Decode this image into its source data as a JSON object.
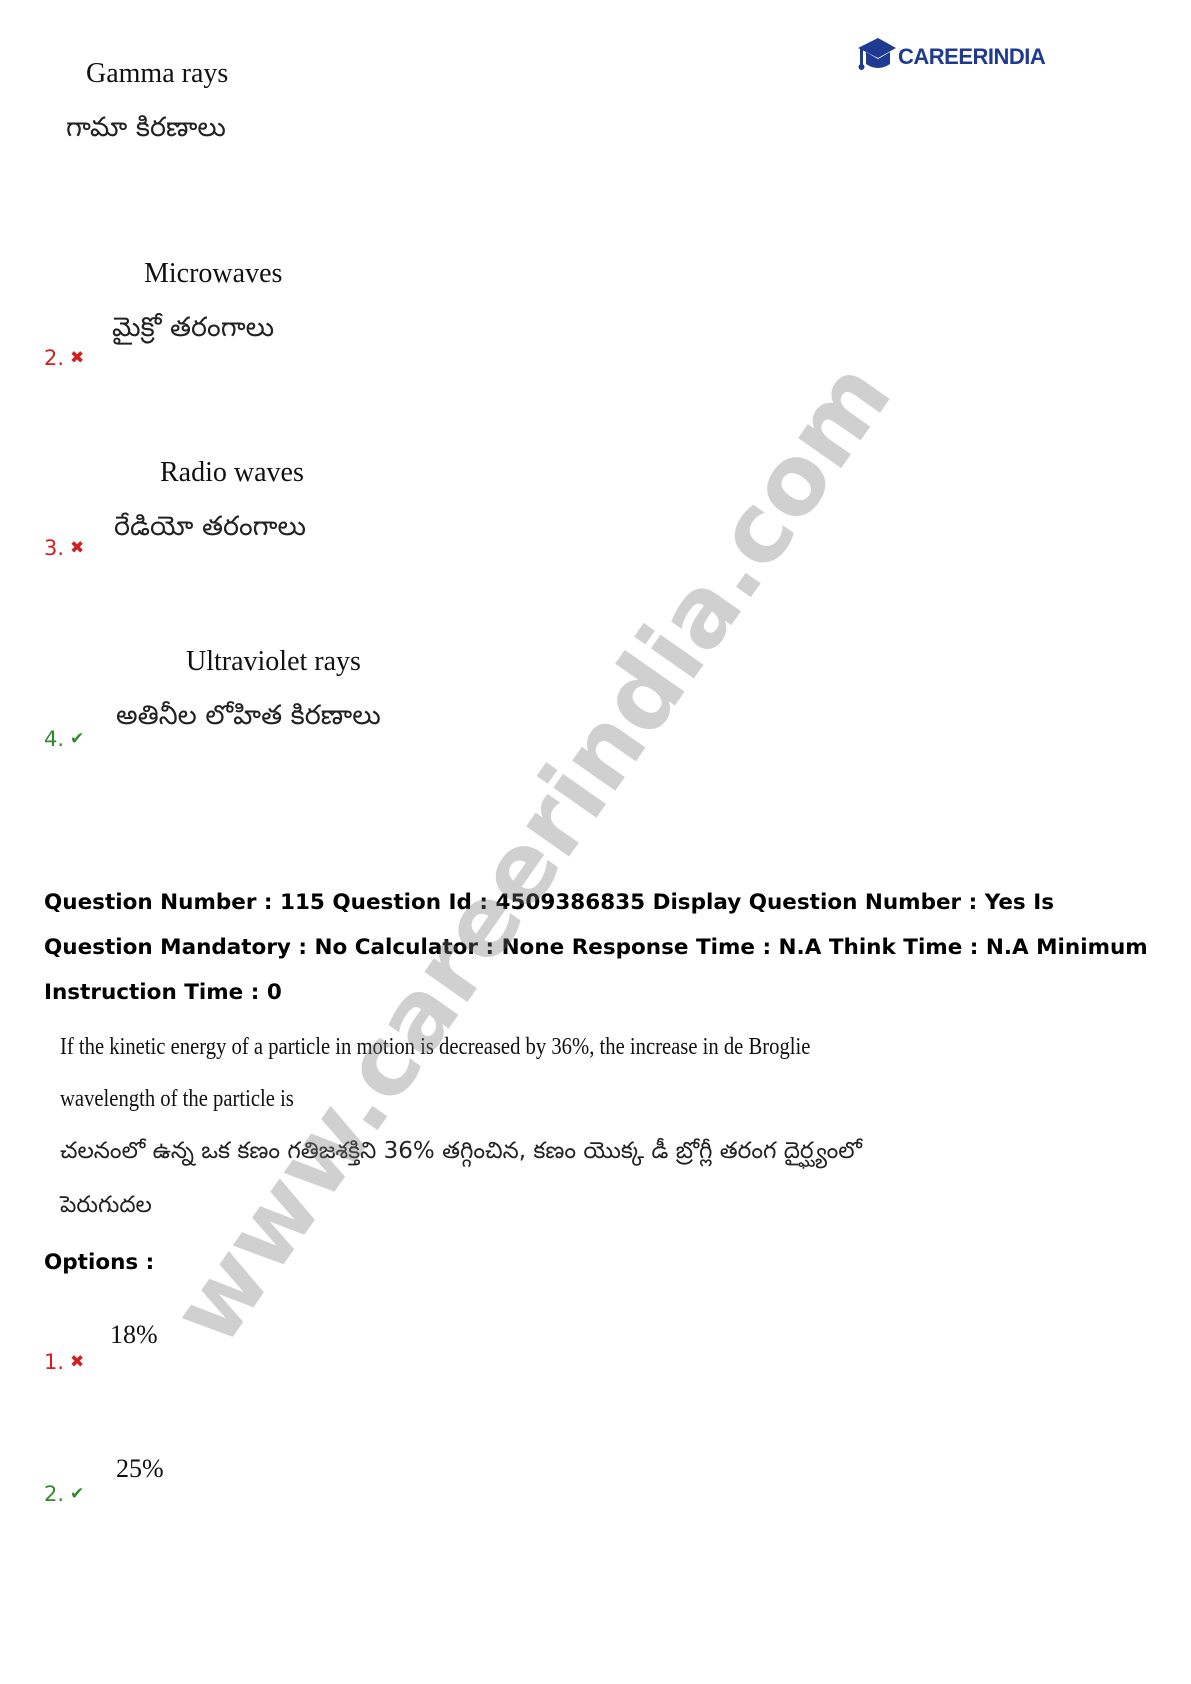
{
  "logo": {
    "text_career": "CAREER",
    "text_india": "INDIA"
  },
  "watermark": "www.careerindia.com",
  "prev_options": [
    {
      "number": "",
      "english": "Gamma rays",
      "telugu": "గామా కిరణాలు",
      "status": "none"
    },
    {
      "number": "2.",
      "english": "Microwaves",
      "telugu": "మైక్రో తరంగాలు",
      "status": "wrong"
    },
    {
      "number": "3.",
      "english": "Radio waves",
      "telugu": "రేడియో తరంగాలు",
      "status": "wrong"
    },
    {
      "number": "4.",
      "english": "Ultraviolet rays",
      "telugu": "అతినీల లోహిత కిరణాలు",
      "status": "correct"
    }
  ],
  "question_meta": "Question Number : 115 Question Id : 4509386835 Display Question Number : Yes Is Question Mandatory : No Calculator : None Response Time : N.A Think Time : N.A Minimum Instruction Time : 0",
  "question": {
    "english_line1": "If the kinetic energy of a particle in motion is decreased by 36%, the increase in de Broglie",
    "english_line2": "wavelength of the particle is",
    "telugu_line1": "చలనంలో ఉన్న ఒక కణం గతిజశక్తిని 36% తగ్గించిన, కణం యొక్క డీ బ్రోగ్లీ తరంగ దైర్ఘ్యంలో",
    "telugu_line2": "పెరుగుదల"
  },
  "options_label": "Options :",
  "options": [
    {
      "number": "1.",
      "value": "18%",
      "status": "wrong"
    },
    {
      "number": "2.",
      "value": "25%",
      "status": "correct"
    }
  ],
  "marks": {
    "wrong": "✖",
    "correct": "✔"
  },
  "colors": {
    "wrong": "#d21f1f",
    "correct": "#2e8b2e",
    "logo": "#1f3a93"
  }
}
